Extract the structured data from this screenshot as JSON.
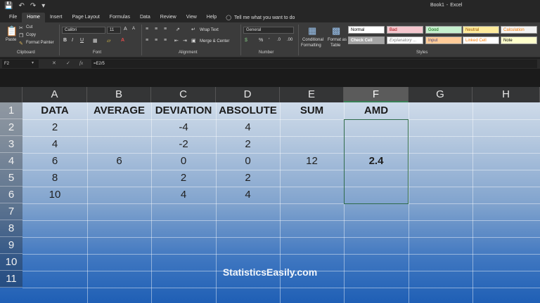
{
  "title_bar": {
    "doc_name": "Book1",
    "separator": "-",
    "app_name": "Excel"
  },
  "tabs": [
    "File",
    "Home",
    "Insert",
    "Page Layout",
    "Formulas",
    "Data",
    "Review",
    "View",
    "Help"
  ],
  "tell_me": "Tell me what you want to do",
  "ribbon": {
    "clipboard": {
      "paste": "Paste",
      "cut": "Cut",
      "copy": "Copy",
      "format_painter": "Format Painter",
      "label": "Clipboard"
    },
    "font": {
      "name": "Calibri",
      "size": "11",
      "bold": "B",
      "italic": "I",
      "underline": "U",
      "label": "Font"
    },
    "alignment": {
      "wrap": "Wrap Text",
      "merge": "Merge & Center",
      "label": "Alignment"
    },
    "number": {
      "format": "General",
      "label": "Number"
    },
    "styles": {
      "conditional_1": "Conditional",
      "conditional_2": "Formatting",
      "format_table_1": "Format as",
      "format_table_2": "Table",
      "normal": "Normal",
      "bad": "Bad",
      "good": "Good",
      "neutral": "Neutral",
      "calculation": "Calculation",
      "check_cell": "Check Cell",
      "explanatory": "Explanatory ...",
      "input": "Input",
      "linked_cell": "Linked Cell",
      "note": "Note",
      "label": "Styles"
    }
  },
  "formula_bar": {
    "name_box": "F2",
    "fx": "fx",
    "formula": "=E2/5"
  },
  "columns": [
    "A",
    "B",
    "C",
    "D",
    "E",
    "F",
    "G",
    "H"
  ],
  "selected_column": "F",
  "rows": [
    "1",
    "2",
    "3",
    "4",
    "5",
    "6",
    "7",
    "8",
    "9",
    "10",
    "11"
  ],
  "headers": {
    "a": "DATA",
    "b": "AVERAGE",
    "c": "DEVIATION",
    "d": "ABSOLUTE",
    "e": "SUM",
    "f": "AMD"
  },
  "data": {
    "a": [
      "2",
      "4",
      "6",
      "8",
      "10"
    ],
    "c": [
      "-4",
      "-2",
      "0",
      "2",
      "4"
    ],
    "d": [
      "4",
      "2",
      "0",
      "2",
      "4"
    ]
  },
  "average": "6",
  "sum": "12",
  "amd": "2.4",
  "watermark": "StatisticsEasily.com",
  "colors": {
    "selection": "#2f6b4a",
    "sheet_top": "#d8e2ee",
    "sheet_bottom": "#1f5fb5"
  }
}
